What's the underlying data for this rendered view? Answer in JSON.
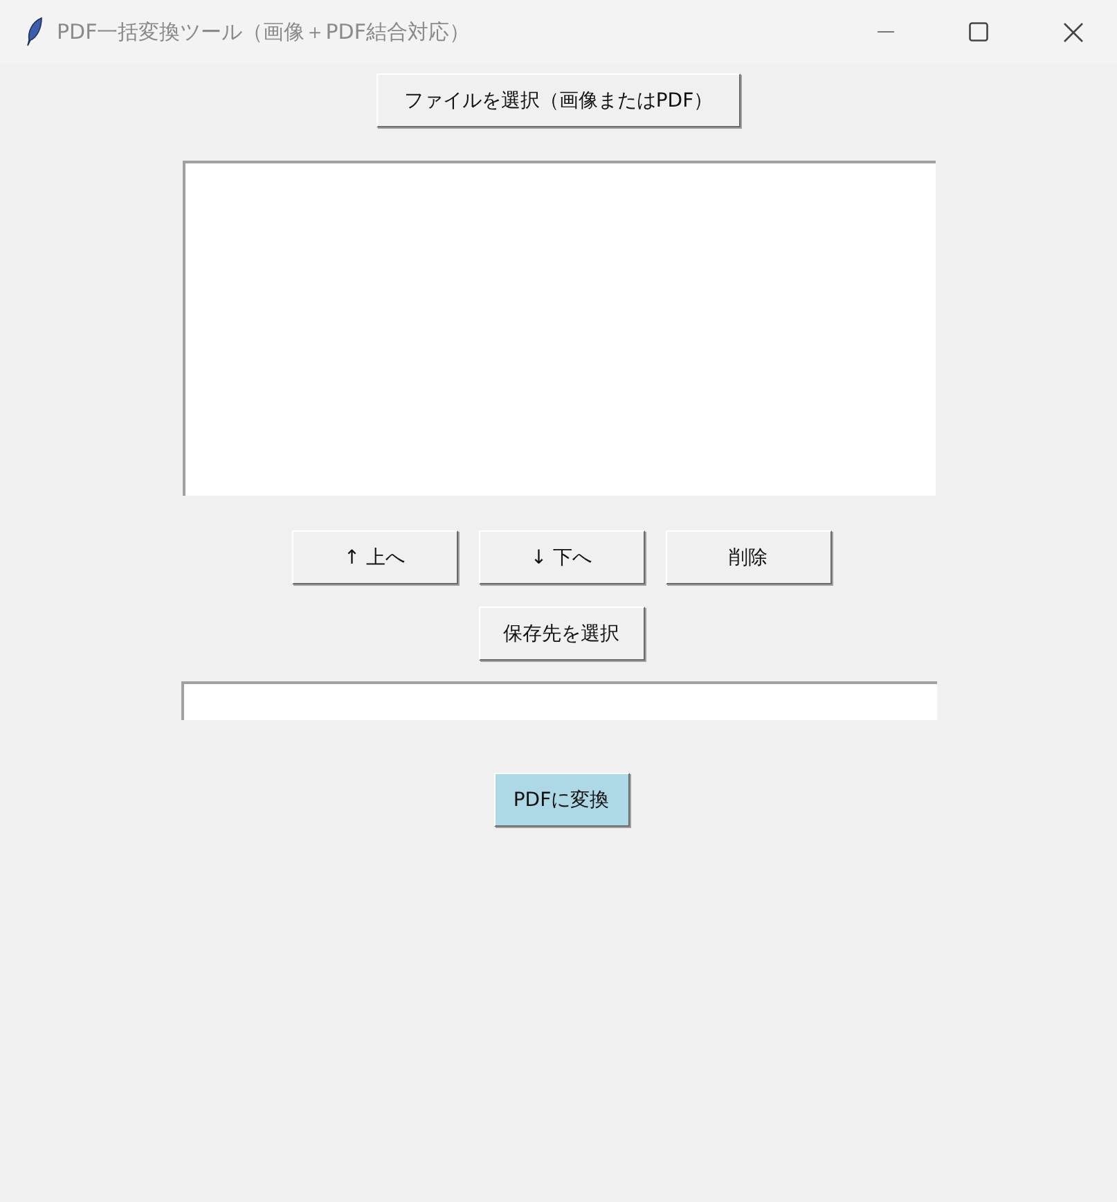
{
  "window": {
    "title": "PDF一括変換ツール（画像＋PDF結合対応）"
  },
  "select_button": "ファイルを選択（画像またはPDF）",
  "list_buttons": [
    "↑ 上へ",
    "↓ 下へ",
    "削除"
  ],
  "save_button": "保存先を選択",
  "convert_button": "PDFに変換"
}
